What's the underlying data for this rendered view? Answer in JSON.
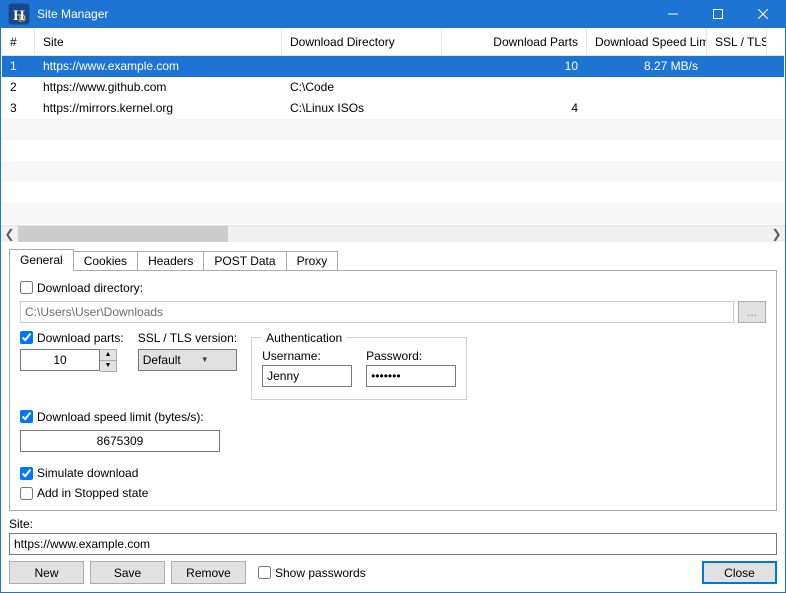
{
  "window": {
    "title": "Site Manager"
  },
  "columns": {
    "num": "#",
    "site": "Site",
    "dir": "Download Directory",
    "parts": "Download Parts",
    "speed": "Download Speed Limit",
    "ssl": "SSL / TLS Ve"
  },
  "rows": [
    {
      "num": "1",
      "site": "https://www.example.com",
      "dir": "",
      "parts": "10",
      "speed": "8.27 MB/s",
      "ssl": ""
    },
    {
      "num": "2",
      "site": "https://www.github.com",
      "dir": "C:\\Code",
      "parts": "",
      "speed": "",
      "ssl": ""
    },
    {
      "num": "3",
      "site": "https://mirrors.kernel.org",
      "dir": "C:\\Linux ISOs",
      "parts": "4",
      "speed": "",
      "ssl": ""
    }
  ],
  "tabs": {
    "general": "General",
    "cookies": "Cookies",
    "headers": "Headers",
    "post": "POST Data",
    "proxy": "Proxy"
  },
  "general": {
    "download_dir_label": "Download directory:",
    "download_dir_value": "C:\\Users\\User\\Downloads",
    "download_parts_label": "Download parts:",
    "download_parts_value": "10",
    "ssl_label": "SSL / TLS version:",
    "ssl_value": "Default",
    "speed_label": "Download speed limit (bytes/s):",
    "speed_value": "8675309",
    "simulate_label": "Simulate download",
    "stopped_label": "Add in Stopped state",
    "auth_legend": "Authentication",
    "username_label": "Username:",
    "username_value": "Jenny",
    "password_label": "Password:",
    "password_value": "•••••••"
  },
  "site": {
    "label": "Site:",
    "value": "https://www.example.com"
  },
  "buttons": {
    "new": "New",
    "save": "Save",
    "remove": "Remove",
    "show_passwords": "Show passwords",
    "close": "Close"
  }
}
